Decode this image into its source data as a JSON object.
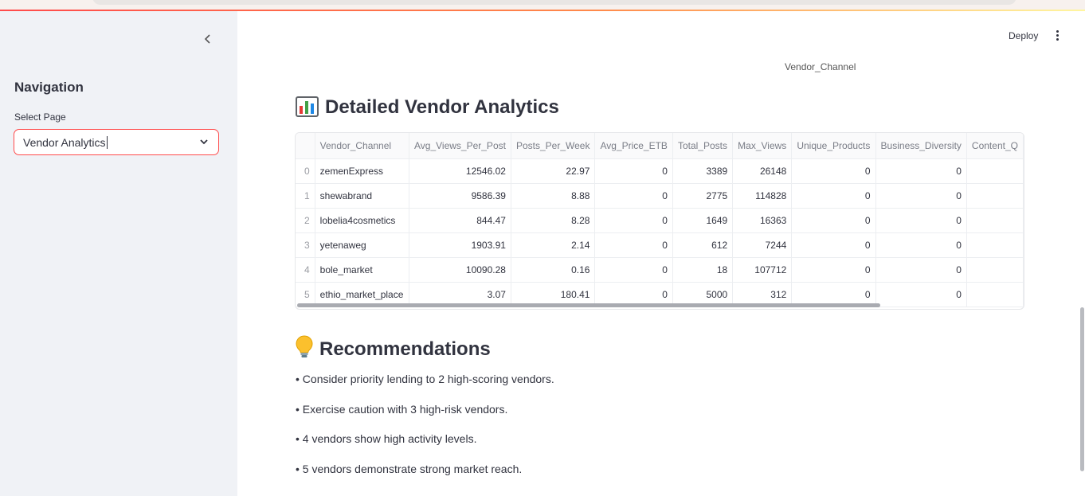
{
  "sidebar": {
    "collapse_icon": "chevron-left-icon",
    "nav_title": "Navigation",
    "select_label": "Select Page",
    "select_value": "Vendor Analytics"
  },
  "header": {
    "deploy_label": "Deploy",
    "menu_icon": "kebab-menu-icon"
  },
  "main": {
    "chart_axis_label": "Vendor_Channel",
    "analytics_title": "Detailed Vendor Analytics",
    "analytics_icon": "bar-chart-emoji",
    "recommendations_title": "Recommendations",
    "recommendations_icon": "lightbulb-emoji",
    "table": {
      "columns": [
        "",
        "Vendor_Channel",
        "Avg_Views_Per_Post",
        "Posts_Per_Week",
        "Avg_Price_ETB",
        "Total_Posts",
        "Max_Views",
        "Unique_Products",
        "Business_Diversity",
        "Content_Q"
      ],
      "rows": [
        [
          "0",
          "zemenExpress",
          "12546.02",
          "22.97",
          "0",
          "3389",
          "26148",
          "0",
          "0",
          ""
        ],
        [
          "1",
          "shewabrand",
          "9586.39",
          "8.88",
          "0",
          "2775",
          "114828",
          "0",
          "0",
          ""
        ],
        [
          "2",
          "lobelia4cosmetics",
          "844.47",
          "8.28",
          "0",
          "1649",
          "16363",
          "0",
          "0",
          ""
        ],
        [
          "3",
          "yetenaweg",
          "1903.91",
          "2.14",
          "0",
          "612",
          "7244",
          "0",
          "0",
          ""
        ],
        [
          "4",
          "bole_market",
          "10090.28",
          "0.16",
          "0",
          "18",
          "107712",
          "0",
          "0",
          ""
        ],
        [
          "5",
          "ethio_market_place",
          "3.07",
          "180.41",
          "0",
          "5000",
          "312",
          "0",
          "0",
          ""
        ]
      ]
    },
    "recommendations": [
      "• Consider priority lending to 2 high-scoring vendors.",
      "• Exercise caution with 3 high-risk vendors.",
      "• 4 vendors show high activity levels.",
      "• 5 vendors demonstrate strong market reach."
    ]
  },
  "colors": {
    "accent": "#ff4b4b",
    "sidebar_bg": "#f0f2f6",
    "text": "#31333f"
  }
}
